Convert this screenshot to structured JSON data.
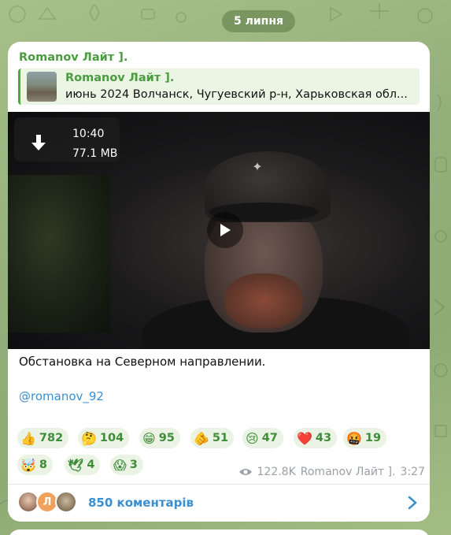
{
  "date_pill": "5 липня",
  "post": {
    "author": "Romanov Лайт ].",
    "reply": {
      "name": "Romanov Лайт ].",
      "text": "июнь 2024 Волчанск, Чугуевский р-н, Харьковская обл..."
    },
    "video": {
      "duration": "10:40",
      "size": "77.1 MB",
      "download_icon": "download-arrow-icon",
      "play_icon": "play-icon"
    },
    "caption": "Обстановка на Северном направлении.",
    "link": "@romanov_92",
    "reactions": [
      {
        "emoji": "👍",
        "count": "782"
      },
      {
        "emoji": "🤔",
        "count": "104"
      },
      {
        "emoji": "😁",
        "count": "95"
      },
      {
        "emoji": "🫵",
        "count": "51"
      },
      {
        "emoji": "😢",
        "count": "47"
      },
      {
        "emoji": "❤️",
        "count": "43"
      },
      {
        "emoji": "🤬",
        "count": "19"
      },
      {
        "emoji": "🤯",
        "count": "8"
      },
      {
        "emoji": "🕊",
        "count": "4"
      },
      {
        "emoji": "😱",
        "count": "3"
      }
    ],
    "views": "122.8K",
    "signature": "Romanov Лайт ].",
    "time": "3:27",
    "comments": {
      "avatar_letter": "Л",
      "label": "850 коментарів"
    }
  },
  "colors": {
    "accent_green": "#4a9c3f",
    "link_blue": "#3a8fd0",
    "reaction_bg": "#eaf3e4"
  }
}
